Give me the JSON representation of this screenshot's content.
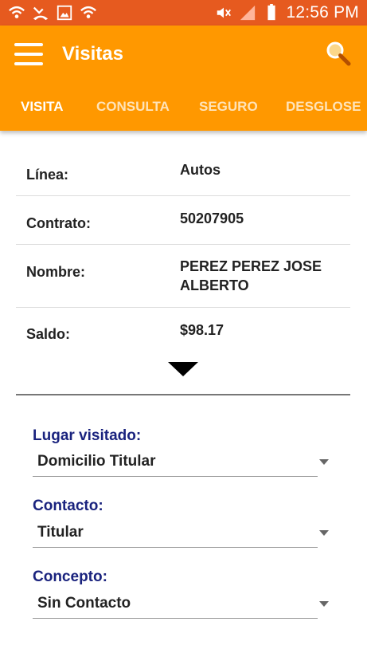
{
  "status_bar": {
    "time": "12:56 PM",
    "icons_left": [
      "wifi-calling-icon",
      "missed-call-icon",
      "gallery-icon",
      "wifi-calling-icon"
    ],
    "icons_right": [
      "mute-icon",
      "signal-icon",
      "battery-icon"
    ]
  },
  "app_bar": {
    "title": "Visitas",
    "color": "#ff9800",
    "tabs": [
      {
        "label": "VISITA",
        "active": true
      },
      {
        "label": "CONSULTA",
        "active": false
      },
      {
        "label": "SEGURO",
        "active": false
      },
      {
        "label": "DESGLOSE",
        "active": false
      }
    ]
  },
  "details": [
    {
      "label": "Línea:",
      "value": "Autos"
    },
    {
      "label": "Contrato:",
      "value": "50207905"
    },
    {
      "label": "Nombre:",
      "value": "PEREZ PEREZ JOSE\nALBERTO"
    },
    {
      "label": "Saldo:",
      "value": "$98.17"
    }
  ],
  "form": {
    "lugar": {
      "label": "Lugar visitado:",
      "value": "Domicilio Titular"
    },
    "contacto": {
      "label": "Contacto:",
      "value": "Titular"
    },
    "concepto": {
      "label": "Concepto:",
      "value": "Sin Contacto"
    }
  }
}
